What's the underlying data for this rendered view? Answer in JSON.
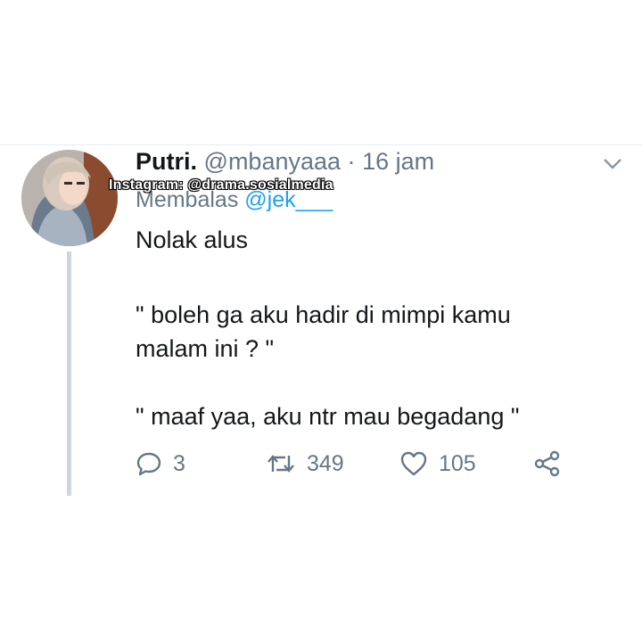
{
  "tweet": {
    "display_name": "Putri.",
    "handle": "@mbanyaaa",
    "separator": "·",
    "time": "16 jam",
    "reply_prefix": "Membalas",
    "reply_handle": "@jek___",
    "text_line1": "Nolak alus",
    "text_line2": "\" boleh ga aku hadir di mimpi kamu",
    "text_line3": "malam ini ? \"",
    "text_line4": "\" maaf yaa, aku ntr mau begadang \""
  },
  "watermark": "Instagram: @drama.sosialmedia",
  "actions": {
    "replies": "3",
    "retweets": "349",
    "likes": "105"
  },
  "icons": {
    "reply": "reply-icon",
    "retweet": "retweet-icon",
    "like": "heart-icon",
    "share": "share-icon",
    "more": "chevron-down-icon"
  },
  "colors": {
    "text": "#14171a",
    "secondary": "#657786",
    "link": "#1da1f2",
    "thread_line": "#ccd6dd"
  }
}
